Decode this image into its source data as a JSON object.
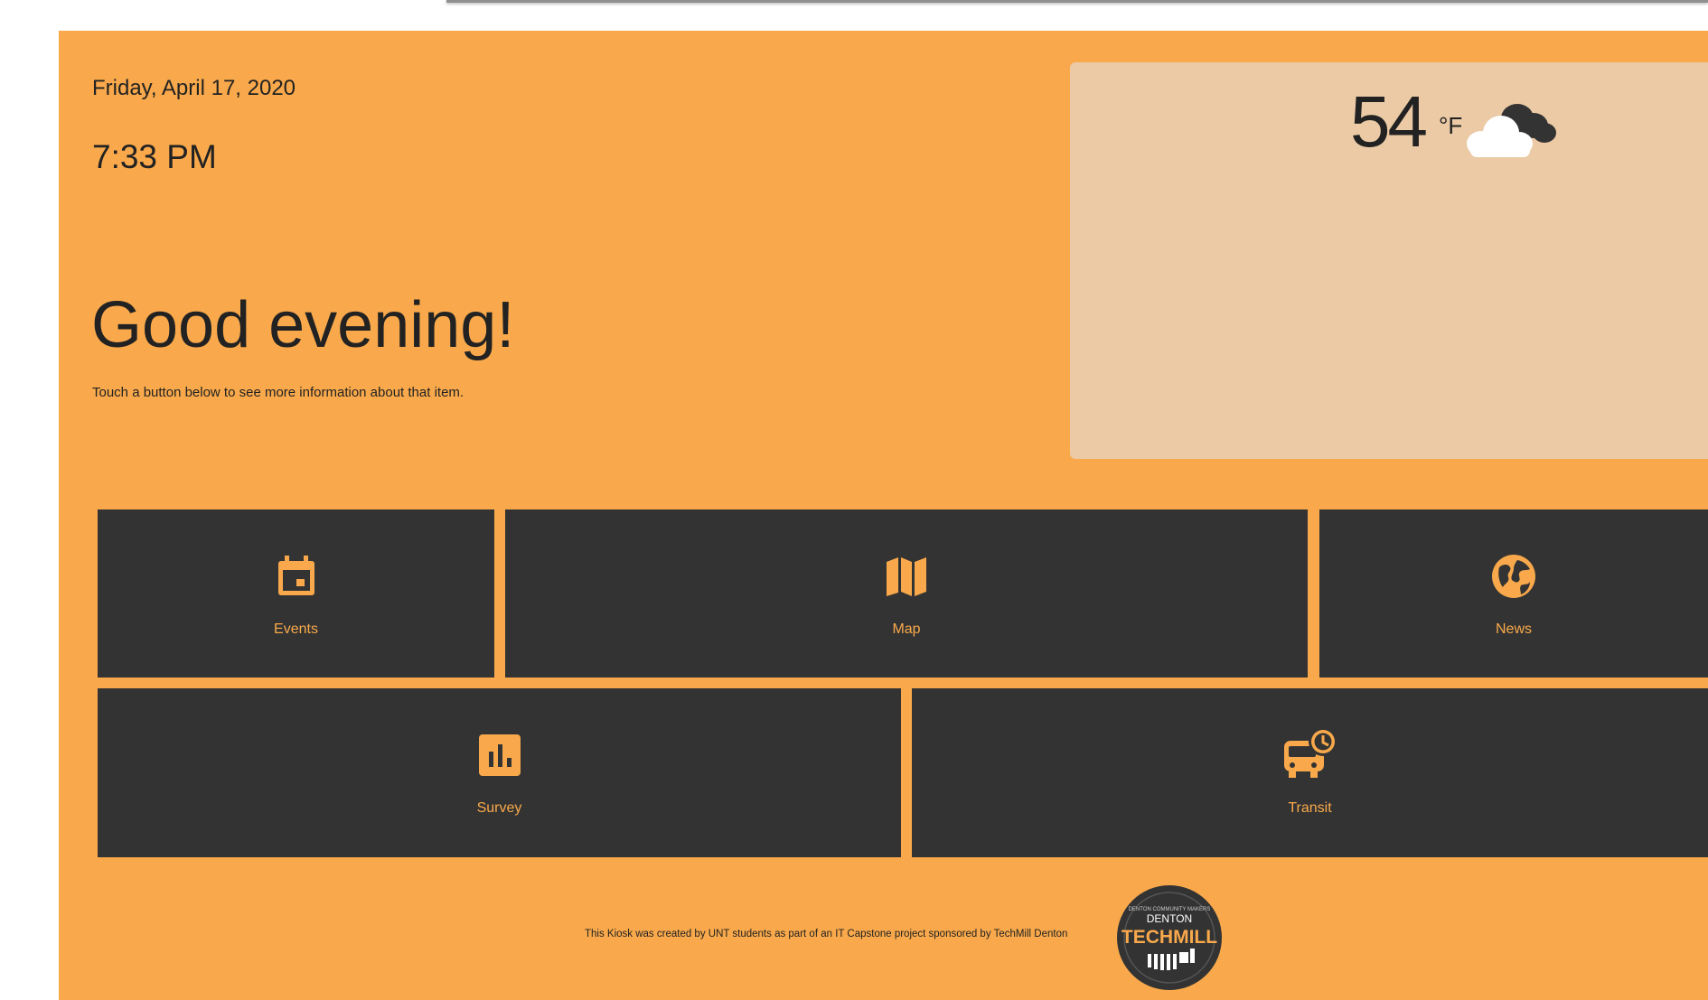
{
  "header": {
    "date": "Friday, April 17, 2020",
    "time": "7:33 PM"
  },
  "greeting": {
    "title": "Good evening!",
    "instruction": "Touch a button below to see more information about that item."
  },
  "weather": {
    "temperature": "54",
    "unit": "°F",
    "condition_icon": "cloudy-icon"
  },
  "tiles": [
    {
      "label": "Events",
      "icon": "calendar-icon"
    },
    {
      "label": "Map",
      "icon": "map-icon"
    },
    {
      "label": "News",
      "icon": "globe-icon"
    },
    {
      "label": "Survey",
      "icon": "bar-chart-icon"
    },
    {
      "label": "Transit",
      "icon": "bus-clock-icon"
    }
  ],
  "footer": {
    "text": "This Kiosk was created by UNT students as part of an IT Capstone project sponsored by TechMill Denton",
    "logo_city": "DENTON",
    "logo_name": "TECHMILL",
    "logo_arc": "DENTON COMMUNITY MAKERS"
  },
  "colors": {
    "background": "#f9a94b",
    "tile": "#333333",
    "weather_panel": "#ebcaa5",
    "text": "#222222"
  }
}
